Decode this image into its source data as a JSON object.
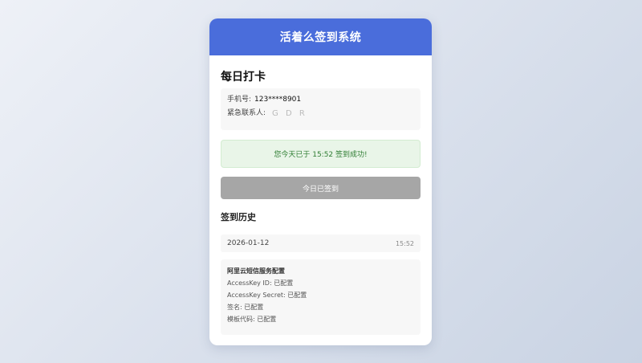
{
  "app": {
    "title": "活着么签到系统"
  },
  "checkin": {
    "section_title": "每日打卡",
    "phone_label": "手机号:",
    "phone_value": "123****8901",
    "contact_label": "紧急联系人:",
    "contact_value": "G D R",
    "success_message": "您今天已于 15:52 签到成功!",
    "button_label": "今日已签到"
  },
  "history": {
    "title": "签到历史",
    "records": [
      {
        "date": "2026-01-12",
        "time": "15:52"
      }
    ]
  },
  "sms_config": {
    "title": "阿里云短信服务配置",
    "items": [
      {
        "text": "AccessKey ID: 已配置"
      },
      {
        "text": "AccessKey Secret: 已配置"
      },
      {
        "text": "签名: 已配置"
      },
      {
        "text": "模板代码: 已配置"
      }
    ]
  },
  "colors": {
    "header_bg": "#4a6ddb",
    "success_bg": "#e9f5e8",
    "success_text": "#2e7d32",
    "button_disabled": "#a6a6a6"
  }
}
